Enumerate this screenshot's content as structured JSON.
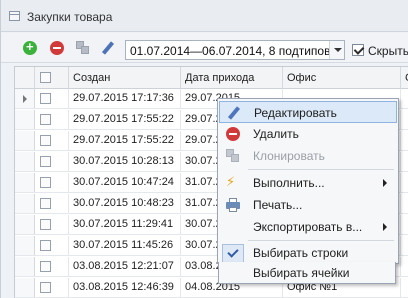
{
  "window": {
    "title": "Закупки товара"
  },
  "toolbar": {
    "date_filter": "01.07.2014—06.07.2014, 8 подтипов",
    "hide_label": "Скрыть"
  },
  "grid": {
    "columns": [
      "Создан",
      "Дата прихода",
      "Офис",
      "С"
    ],
    "rows": [
      {
        "created": "29.07.2015 17:17:36",
        "arrival": "29.07.2015",
        "office": ""
      },
      {
        "created": "29.07.2015 17:55:22",
        "arrival": "29.07.2015",
        "office": ""
      },
      {
        "created": "29.07.2015 17:55:22",
        "arrival": "29.07.2015",
        "office": ""
      },
      {
        "created": "30.07.2015 10:28:13",
        "arrival": "30.07.2015",
        "office": ""
      },
      {
        "created": "30.07.2015 10:47:24",
        "arrival": "31.07.2015",
        "office": ""
      },
      {
        "created": "30.07.2015 10:48:23",
        "arrival": "31.07.2015",
        "office": ""
      },
      {
        "created": "30.07.2015 11:29:41",
        "arrival": "30.07.2015",
        "office": ""
      },
      {
        "created": "30.07.2015 11:45:26",
        "arrival": "30.07.2015",
        "office": ""
      },
      {
        "created": "03.08.2015 12:21:07",
        "arrival": "03.08.2015",
        "office": ""
      },
      {
        "created": "03.08.2015 12:46:39",
        "arrival": "04.08.2015",
        "office": "Офис №1"
      }
    ]
  },
  "context_menu": {
    "items": [
      {
        "label": "Редактировать",
        "icon": "pencil-icon"
      },
      {
        "label": "Удалить",
        "icon": "delete-icon"
      },
      {
        "label": "Клонировать",
        "icon": "clone-icon",
        "disabled": true
      },
      {
        "label": "Выполнить...",
        "icon": "bolt-icon",
        "submenu": true
      },
      {
        "label": "Печать...",
        "icon": "printer-icon"
      },
      {
        "label": "Экспортировать в...",
        "submenu": true
      },
      {
        "label": "Выбирать строки",
        "icon": "check-icon",
        "checked": true
      },
      {
        "label": "Выбирать ячейки"
      }
    ]
  }
}
